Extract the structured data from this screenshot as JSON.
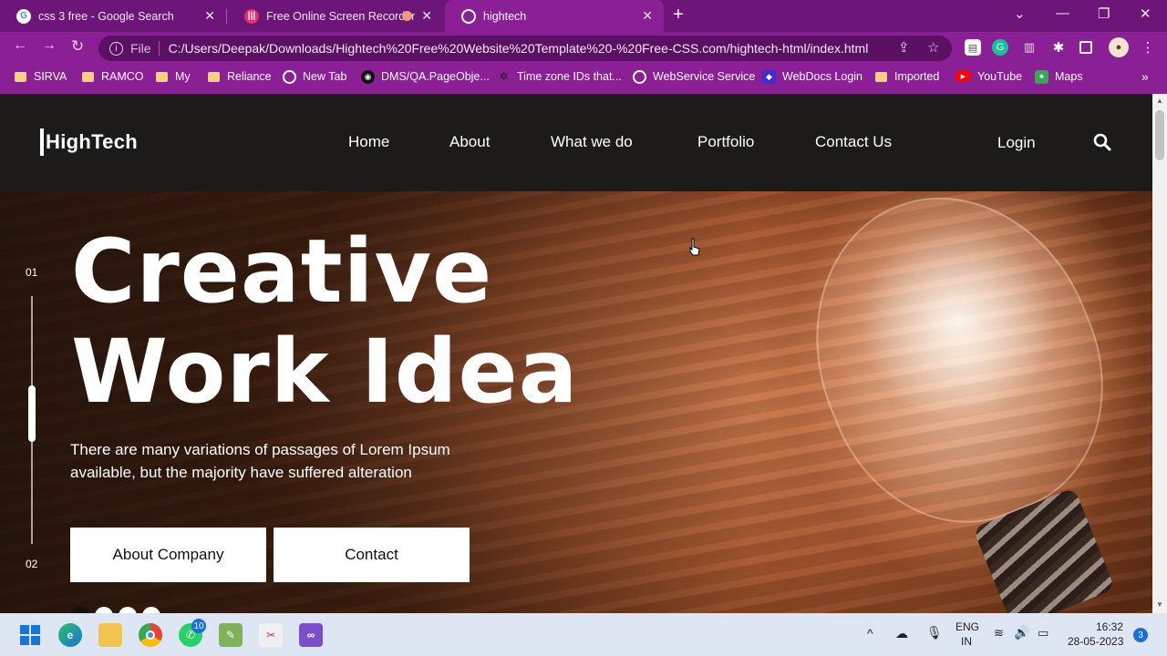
{
  "browser": {
    "tabs": [
      {
        "title": "css 3 free - Google Search",
        "icon": "google-icon"
      },
      {
        "title": "Free Online Screen Recorder",
        "icon": "recorder-icon"
      },
      {
        "title": "hightech",
        "icon": "globe-icon"
      }
    ],
    "address": {
      "scheme_label": "File",
      "url": "C:/Users/Deepak/Downloads/Hightech%20Free%20Website%20Template%20-%20Free-CSS.com/hightech-html/index.html"
    },
    "bookmarks": [
      {
        "label": "SIRVA",
        "icon": "folder-icon"
      },
      {
        "label": "RAMCO",
        "icon": "folder-icon"
      },
      {
        "label": "My",
        "icon": "folder-icon"
      },
      {
        "label": "Reliance",
        "icon": "folder-icon"
      },
      {
        "label": "New Tab",
        "icon": "globe-icon"
      },
      {
        "label": "DMS/QA.PageObje...",
        "icon": "github-icon"
      },
      {
        "label": "Time zone IDs that...",
        "icon": "bug-icon"
      },
      {
        "label": "WebService Service",
        "icon": "globe-icon"
      },
      {
        "label": "WebDocs Login",
        "icon": "webdocs-icon"
      },
      {
        "label": "Imported",
        "icon": "folder-icon"
      },
      {
        "label": "YouTube",
        "icon": "youtube-icon"
      },
      {
        "label": "Maps",
        "icon": "maps-icon"
      }
    ],
    "bookmarks_more": "»"
  },
  "site": {
    "logo": "HighTech",
    "nav": [
      "Home",
      "About",
      "What we do",
      "Portfolio",
      "Contact Us"
    ],
    "login": "Login",
    "slider": {
      "first": "01",
      "last": "02"
    },
    "headline_line1": "Creative",
    "headline_line2": "Work Idea",
    "subtext": "There are many variations of passages of Lorem Ipsum available, but the majority have suffered alteration",
    "buttons": {
      "primary": "About Company",
      "secondary": "Contact"
    }
  },
  "taskbar": {
    "language": "ENG",
    "region": "IN",
    "time": "16:32",
    "date": "28-05-2023",
    "notifications": "3",
    "whatsapp_badge": "10"
  },
  "colors": {
    "chrome": "#8a1f96",
    "header": "#1c1b1a",
    "accent": "#ffffff"
  }
}
